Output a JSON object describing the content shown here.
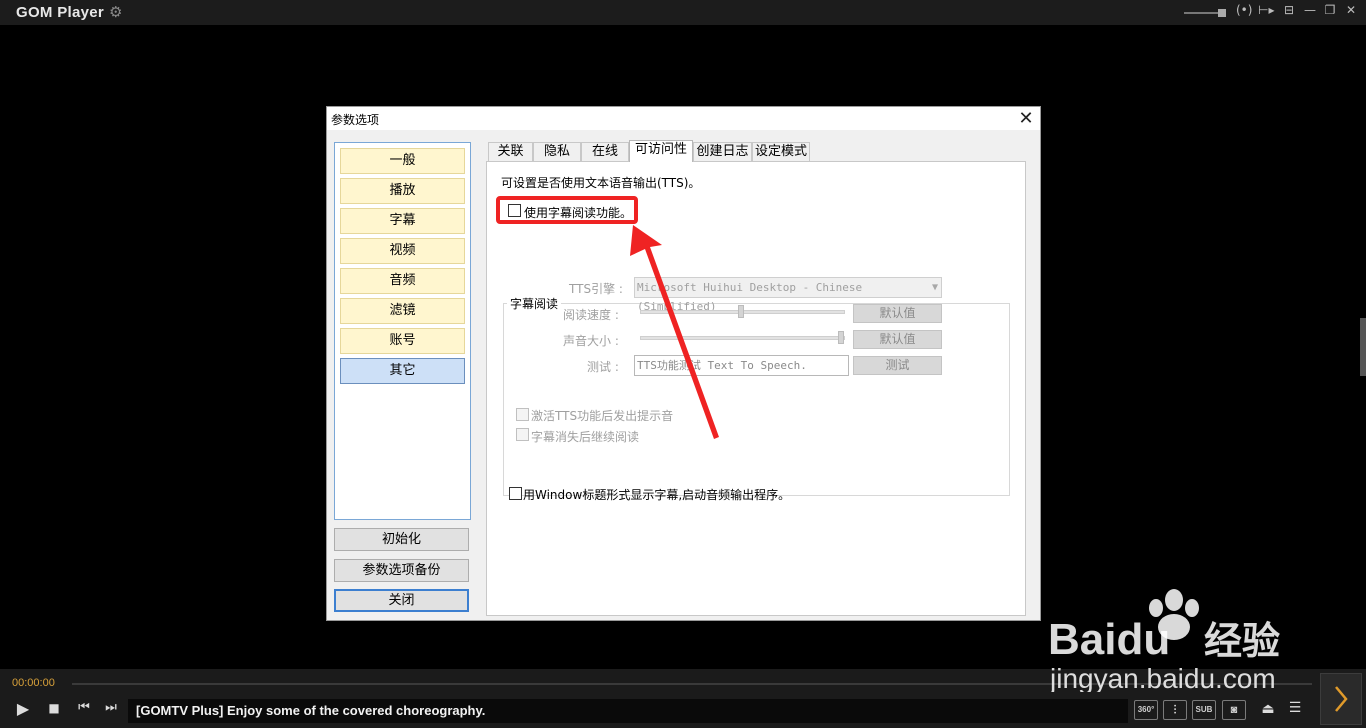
{
  "app": {
    "name": "GOM Player",
    "window_controls": [
      "—",
      "(•)",
      "⊢▸",
      "⊟",
      "—",
      "❐",
      "✕"
    ]
  },
  "dialog": {
    "title": "参数选项",
    "close": "✕",
    "nav": [
      "一般",
      "播放",
      "字幕",
      "视频",
      "音频",
      "滤镜",
      "账号",
      "其它"
    ],
    "nav_active_index": 7,
    "buttons": {
      "reset": "初始化",
      "backup": "参数选项备份",
      "close": "关闭"
    },
    "tabs": [
      "关联",
      "隐私",
      "在线",
      "可访问性",
      "创建日志",
      "设定模式"
    ],
    "active_tab_index": 3,
    "page": {
      "intro": "可设置是否使用文本语音输出(TTS)。",
      "enable_reading": {
        "label": "使用字幕阅读功能。",
        "checked": false
      },
      "group_title": "字幕阅读",
      "tts_engine": {
        "label": "TTS引擎 :",
        "value": "Microsoft Huihui Desktop - Chinese (Simplified)"
      },
      "read_speed": {
        "label": "阅读速度 :",
        "button": "默认值",
        "level": 0.5
      },
      "volume": {
        "label": "声音大小 :",
        "button": "默认值",
        "level": 1.0
      },
      "test": {
        "label": "测试 :",
        "value": "TTS功能测试 Text To Speech.",
        "button": "测试"
      },
      "opt_alert": {
        "label": "激活TTS功能后发出提示音",
        "checked": false
      },
      "opt_continue": {
        "label": "字幕消失后继续阅读",
        "checked": false
      },
      "opt_window_title": {
        "label": "用Window标题形式显示字幕,启动音频输出程序。",
        "checked": false
      }
    }
  },
  "player": {
    "time": "00:00:00",
    "ticker": "[GOMTV Plus] Enjoy some of the covered choreography.",
    "buttons": {
      "play": "▶",
      "stop": "■",
      "prev": "⏮",
      "next": "⏭"
    },
    "right_buttons": {
      "vr": "360°",
      "eq": "⫶",
      "sub": "SUB",
      "capture": "◙",
      "eject": "⏏",
      "menu": "☰"
    }
  },
  "watermark": {
    "brand": "Baidu",
    "brand_cn": "经验",
    "url": "jingyan.baidu.com"
  },
  "colors": {
    "highlight": "#ef2323",
    "accent": "#d8a13a",
    "nav_bg": "#fff6cf",
    "nav_active": "#cde0f7"
  }
}
